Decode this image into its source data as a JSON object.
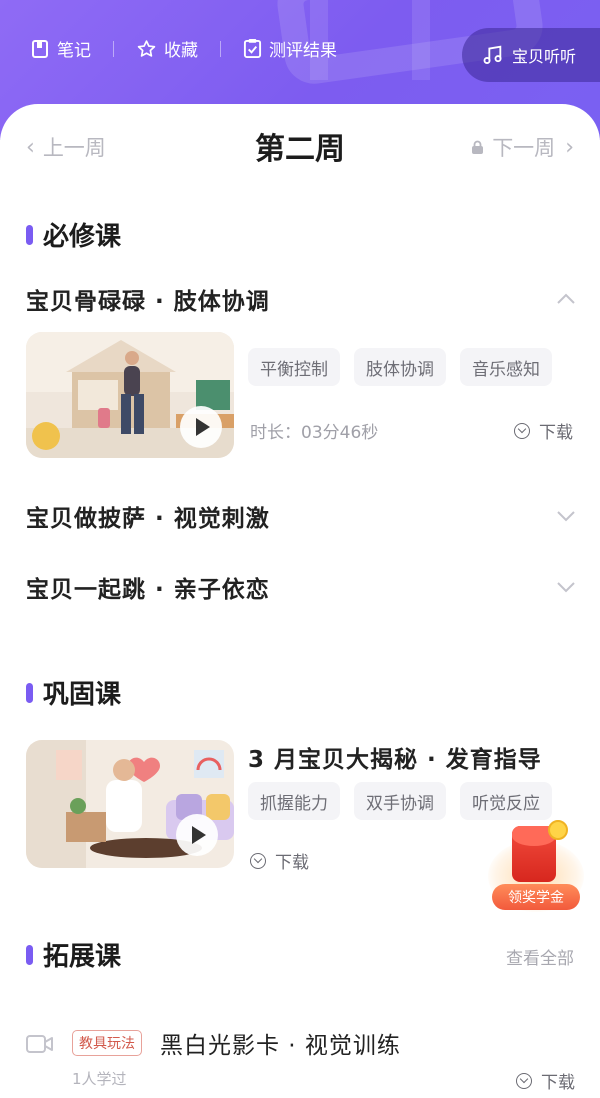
{
  "header": {
    "tools": [
      {
        "label": "笔记",
        "icon": "notebook-icon"
      },
      {
        "label": "收藏",
        "icon": "star-icon"
      },
      {
        "label": "测评结果",
        "icon": "checklist-icon"
      }
    ],
    "listen": {
      "label": "宝贝听听",
      "icon": "music-note-icon"
    }
  },
  "week_nav": {
    "prev_label": "上一周",
    "title": "第二周",
    "next_label": "下一周"
  },
  "required": {
    "heading": "必修课",
    "lessons": [
      {
        "title": "宝贝骨碌碌 · 肢体协调",
        "expanded": true
      },
      {
        "title": "宝贝做披萨 · 视觉刺激",
        "expanded": false
      },
      {
        "title": "宝贝一起跳 · 亲子依恋",
        "expanded": false
      }
    ],
    "expanded_detail": {
      "tags": [
        "平衡控制",
        "肢体协调",
        "音乐感知"
      ],
      "duration": "时长：03分46秒",
      "download_label": "下载"
    }
  },
  "consolidate": {
    "heading": "巩固课",
    "title": "3 月宝贝大揭秘 · 发育指导",
    "tags": [
      "抓握能力",
      "双手协调",
      "听觉反应"
    ],
    "download_label": "下载"
  },
  "extension": {
    "heading": "拓展课",
    "view_all": "查看全部",
    "items": [
      {
        "badge": "教具玩法",
        "title": "黑白光影卡 · 视觉训练",
        "learners": "1人学过",
        "download_label": "下载"
      }
    ]
  },
  "reward": {
    "label": "领奖学金"
  },
  "colors": {
    "accent": "#7a5cf2",
    "header_bg": "#8a68f4"
  }
}
